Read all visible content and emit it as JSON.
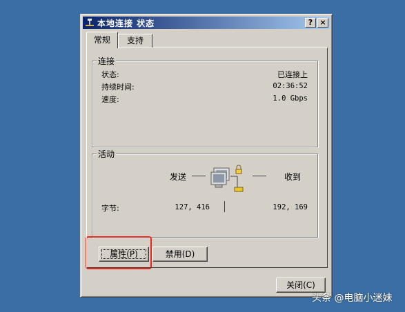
{
  "window": {
    "title": "本地连接 状态",
    "help_label": "?",
    "close_label": "×"
  },
  "tabs": [
    {
      "label": "常规"
    },
    {
      "label": "支持"
    }
  ],
  "connection": {
    "legend": "连接",
    "status_label": "状态:",
    "status_value": "已连接上",
    "duration_label": "持续时间:",
    "duration_value": "02:36:52",
    "speed_label": "速度:",
    "speed_value": "1.0 Gbps"
  },
  "activity": {
    "legend": "活动",
    "sent_label": "发送",
    "received_label": "收到",
    "bytes_label": "字节:",
    "bytes_sent": "127, 416",
    "bytes_received": "192, 169"
  },
  "buttons": {
    "properties": "属性(P)",
    "disable": "禁用(D)",
    "close": "关闭(C)"
  },
  "watermark": "头条 @电脑小迷妹"
}
